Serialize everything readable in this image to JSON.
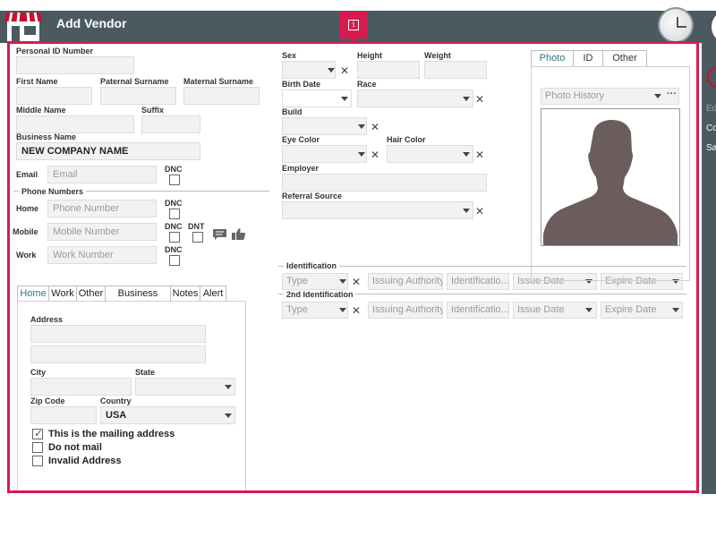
{
  "window": {
    "title": "Add Vendor",
    "info_icon": "info-icon",
    "right_panel_labels": [
      "Ed",
      "Co",
      "Sa"
    ]
  },
  "colors": {
    "accent": "#d81b4f",
    "titlebar": "#4a5a60",
    "active_tab": "#2a7a8a"
  },
  "person": {
    "personal_id_label": "Personal ID Number",
    "personal_id_value": "",
    "first_name_label": "First Name",
    "first_name_value": "",
    "paternal_surname_label": "Paternal Surname",
    "paternal_surname_value": "",
    "maternal_surname_label": "Maternal Surname",
    "maternal_surname_value": "",
    "middle_name_label": "Middle Name",
    "middle_name_value": "",
    "suffix_label": "Suffix",
    "suffix_value": "",
    "business_name_label": "Business Name",
    "business_name_value": "NEW COMPANY NAME",
    "email_label": "Email",
    "email_placeholder": "Email",
    "dnc_label": "DNC"
  },
  "phones": {
    "section_label": "Phone Numbers",
    "home_label": "Home",
    "home_placeholder": "Phone Number",
    "mobile_label": "Mobile",
    "mobile_placeholder": "Mobile Number",
    "work_label": "Work",
    "work_placeholder": "Work Number",
    "dnc_label": "DNC",
    "dnt_label": "DNT"
  },
  "address_tabs": [
    "Home",
    "Work",
    "Other",
    "Business",
    "Notes",
    "Alert"
  ],
  "address": {
    "address_label": "Address",
    "city_label": "City",
    "state_label": "State",
    "state_value": "",
    "zip_label": "Zip Code",
    "country_label": "Country",
    "country_value": "USA",
    "checks": [
      {
        "label": "This is the mailing address",
        "checked": true
      },
      {
        "label": "Do not mail",
        "checked": false
      },
      {
        "label": "Invalid Address",
        "checked": false
      }
    ]
  },
  "details": {
    "sex_label": "Sex",
    "height_label": "Height",
    "weight_label": "Weight",
    "birth_date_label": "Birth Date",
    "race_label": "Race",
    "build_label": "Build",
    "eye_color_label": "Eye Color",
    "hair_color_label": "Hair Color",
    "employer_label": "Employer",
    "referral_source_label": "Referral Source"
  },
  "identification": {
    "section_label": "Identification",
    "second_section_label": "2nd Identification",
    "type_placeholder": "Type",
    "issuing_authority_placeholder": "Issuing Authority",
    "identification_placeholder": "Identificatio...",
    "issue_date_placeholder": "Issue Date",
    "expire_date_placeholder": "Expire Date"
  },
  "photo": {
    "tabs": [
      "Photo",
      "ID",
      "Other"
    ],
    "history_placeholder": "Photo History",
    "more_label": "···"
  }
}
